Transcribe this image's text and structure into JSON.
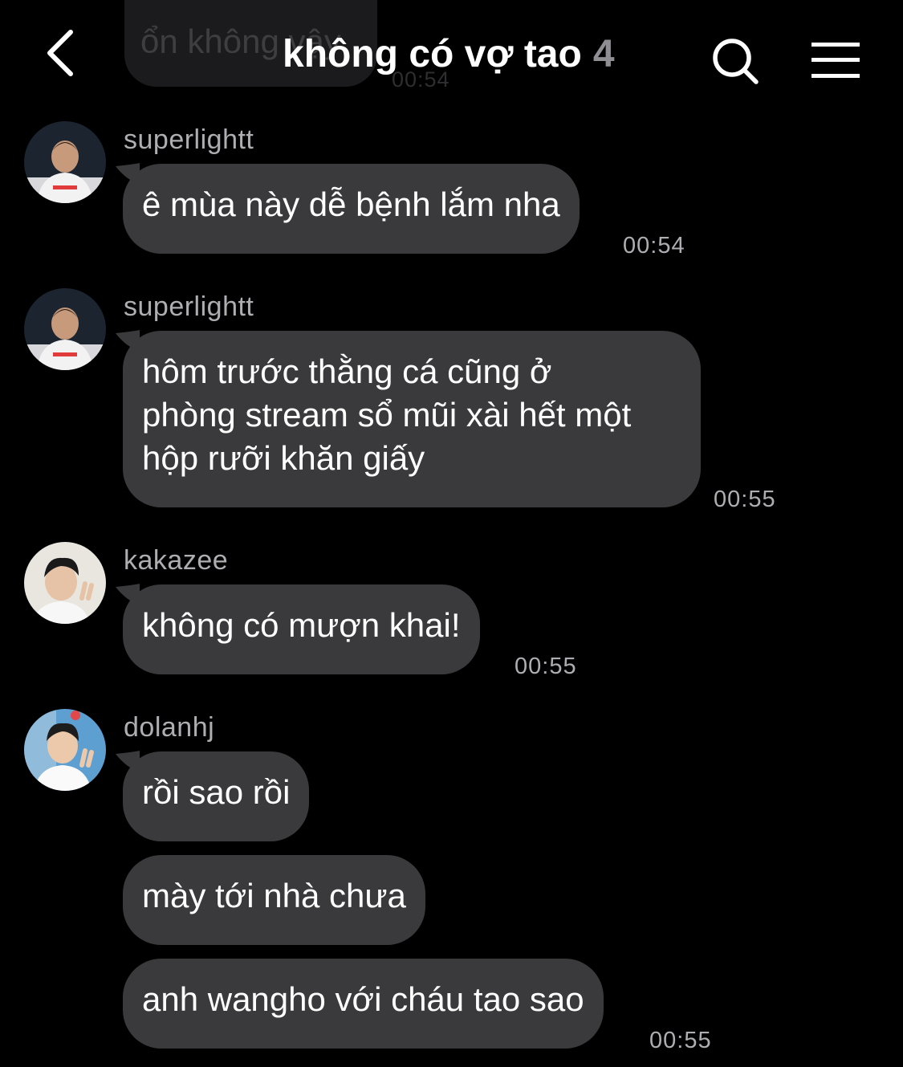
{
  "previous": {
    "text": "ổn không vậy",
    "time": "00:54"
  },
  "header": {
    "title": "không có vợ tao",
    "member_count": "4"
  },
  "messages": [
    {
      "sender": "superlightt",
      "lines": [
        "ê mùa này dễ bệnh lắm nha"
      ],
      "time": "00:54"
    },
    {
      "sender": "superlightt",
      "lines": [
        "hôm trước thằng cá cũng ở",
        "phòng stream sổ mũi xài hết một",
        "hộp rưỡi khăn giấy"
      ],
      "time": "00:55"
    },
    {
      "sender": "kakazee",
      "lines": [
        "không có mượn khai!"
      ],
      "time": "00:55"
    },
    {
      "sender": "dolanhj",
      "lines": [
        "rồi sao rồi"
      ]
    },
    {
      "lines": [
        "mày tới nhà chưa"
      ]
    },
    {
      "lines": [
        "anh wangho với cháu tao sao"
      ],
      "time": "00:55"
    }
  ],
  "colors": {
    "background": "#000000",
    "bubble": "#3a3a3c",
    "secondary_text": "#aeaeb2"
  },
  "icons": {
    "back": "chevron-left-icon",
    "search": "search-icon",
    "menu": "hamburger-menu-icon"
  }
}
